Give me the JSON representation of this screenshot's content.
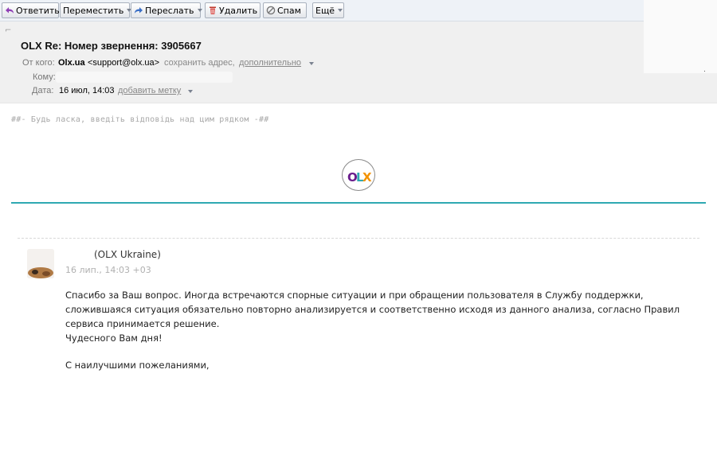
{
  "toolbar": {
    "reply_label": "Ответить",
    "move_label": "Переместить",
    "forward_label": "Переслать",
    "delete_label": "Удалить",
    "spam_label": "Спам",
    "more_label": "Ещё"
  },
  "message": {
    "subject": "OLX Re: Номер звернення: 3905667",
    "from_label": "От кого:",
    "from_name": "Olx.ua",
    "from_email": "<support@olx.ua>",
    "save_address_link": "сохранить адрес,",
    "details_link": "дополнительно",
    "to_label": "Кому:",
    "date_label": "Дата:",
    "date_value": "16 июл, 14:03",
    "add_label_link": "добавить метку"
  },
  "body": {
    "reply_note": "##- Будь ласка, введіть відповідь над цим рядком -##",
    "logo_text": "OLX",
    "author": "(OLX Ukraine)",
    "timestamp": "16 лип., 14:03 +03",
    "lines": [
      "Спасибо за Ваш вопрос. Иногда встречаются спорные ситуации и при обращении пользователя в Службу поддержки,",
      "сложившаяся ситуация обязательно повторно анализируется и соответственно исходя из данного анализа, согласно Правил",
      "сервиса принимается решение.",
      "Чудесного Вам дня!",
      "С наилучшими пожеланиями,"
    ]
  },
  "colors": {
    "accent_line": "#2fa9b2",
    "olx_o": "#6a1d8c",
    "olx_l": "#2fa9b2",
    "olx_x": "#f39200"
  }
}
